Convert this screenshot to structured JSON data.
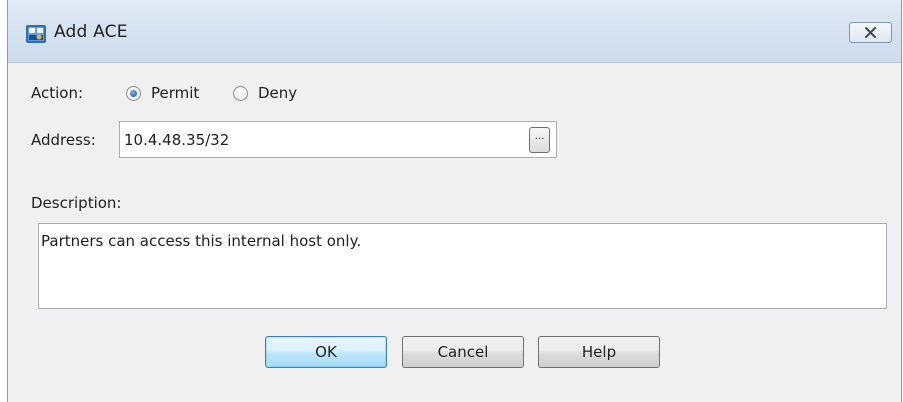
{
  "window": {
    "title": "Add ACE",
    "close_symbol": "✕"
  },
  "action": {
    "label": "Action:",
    "options": [
      {
        "label": "Permit",
        "selected": true
      },
      {
        "label": "Deny",
        "selected": false
      }
    ]
  },
  "address": {
    "label": "Address:",
    "value": "10.4.48.35/32",
    "browse_label": "..."
  },
  "description": {
    "label": "Description:",
    "value": "Partners can access this internal host only."
  },
  "buttons": {
    "ok": "OK",
    "cancel": "Cancel",
    "help": "Help"
  },
  "icons": {
    "app": "asdm-app-icon",
    "close": "close-icon"
  },
  "colors": {
    "titlebar": "#d6e2f0",
    "dialog_bg": "#f0f0f0",
    "radio_selected": "#1d5fb3",
    "default_button_border": "#3c7fb1"
  }
}
